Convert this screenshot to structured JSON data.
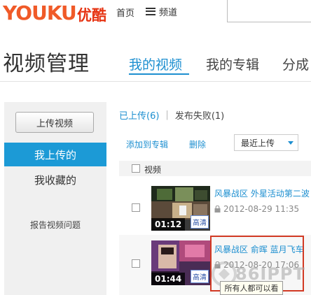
{
  "header": {
    "logo_word": "YOUKU",
    "logo_cn": "优酷",
    "nav_home": "首页",
    "nav_channel": "频道",
    "brand_color": "#f05a28"
  },
  "page": {
    "title": "视频管理",
    "tabs": [
      {
        "label": "我的视频",
        "active": true
      },
      {
        "label": "我的专辑",
        "active": false
      },
      {
        "label": "分成",
        "active": false
      }
    ],
    "accent_color": "#1d8fd0"
  },
  "sidebar": {
    "upload_button": "上传视频",
    "items": [
      {
        "label": "我上传的",
        "active": true
      },
      {
        "label": "我收藏的",
        "active": false
      }
    ],
    "report_link": "报告视频问题",
    "active_color": "#1c9ad6"
  },
  "main": {
    "uploaded_filter": "已上传(6)",
    "separator": "|",
    "failed_filter": "发布失败(1)",
    "toolbar": {
      "add_to_album": "添加到专辑",
      "delete": "删除",
      "sort_selected": "最近上传"
    },
    "list_header": {
      "video_column": "视频"
    },
    "rows": [
      {
        "title": "风暴战区 外星活动第二波",
        "date": "2012-08-29 11:35",
        "duration": "01:12",
        "badge": "高清",
        "privacy_icon": "lock-icon"
      },
      {
        "title": "风暴战区 俞晖 蓝月飞车",
        "date": "2012-08-20 17:06",
        "duration": "01:44",
        "badge": "高清",
        "privacy_icon": "lock-icon"
      }
    ],
    "privacy_tip": "所有人都可以看"
  },
  "watermark": {
    "text": "86IPPT"
  }
}
